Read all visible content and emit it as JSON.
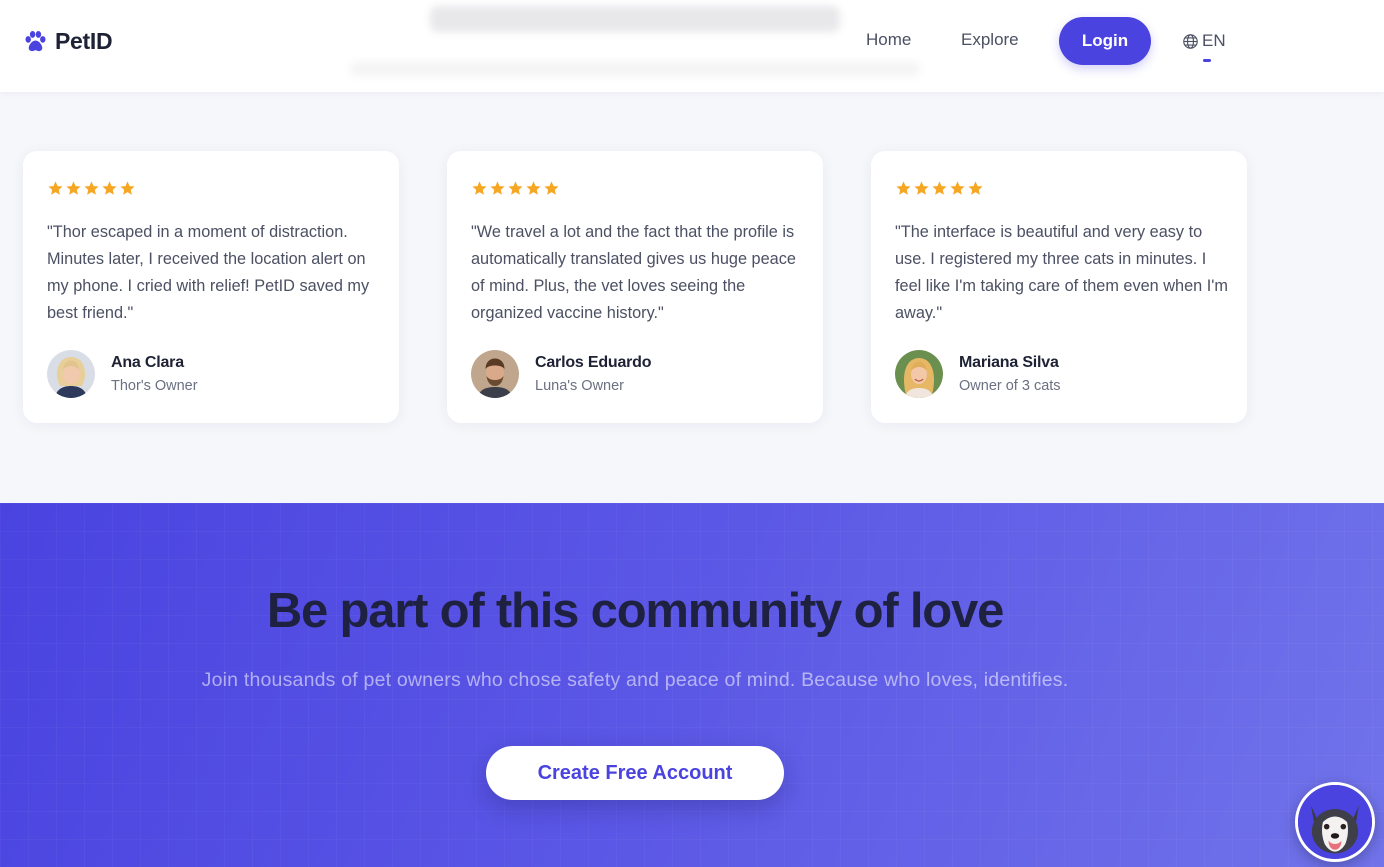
{
  "header": {
    "logo_text": "PetID",
    "nav": {
      "home": "Home",
      "explore": "Explore"
    },
    "login_label": "Login",
    "language": "EN"
  },
  "testimonials": [
    {
      "rating": 5,
      "quote": "\"Thor escaped in a moment of distraction. Minutes later, I received the location alert on my phone. I cried with relief! PetID saved my best friend.\"",
      "name": "Ana Clara",
      "role": "Thor's Owner"
    },
    {
      "rating": 5,
      "quote": "\"We travel a lot and the fact that the profile is automatically translated gives us huge peace of mind. Plus, the vet loves seeing the organized vaccine history.\"",
      "name": "Carlos Eduardo",
      "role": "Luna's Owner"
    },
    {
      "rating": 5,
      "quote": "\"The interface is beautiful and very easy to use. I registered my three cats in minutes. I feel like I'm taking care of them even when I'm away.\"",
      "name": "Mariana Silva",
      "role": "Owner of 3 cats"
    }
  ],
  "cta": {
    "title": "Be part of this community of love",
    "subtitle": "Join thousands of pet owners who chose safety and peace of mind. Because who loves, identifies.",
    "button_label": "Create Free Account"
  },
  "colors": {
    "accent": "#4a43e0",
    "star": "#f5a623",
    "heading": "#1e2235"
  },
  "icons": {
    "logo": "paw-icon",
    "language": "globe-icon",
    "rating": "star-icon",
    "assistant": "husky-avatar-icon"
  }
}
